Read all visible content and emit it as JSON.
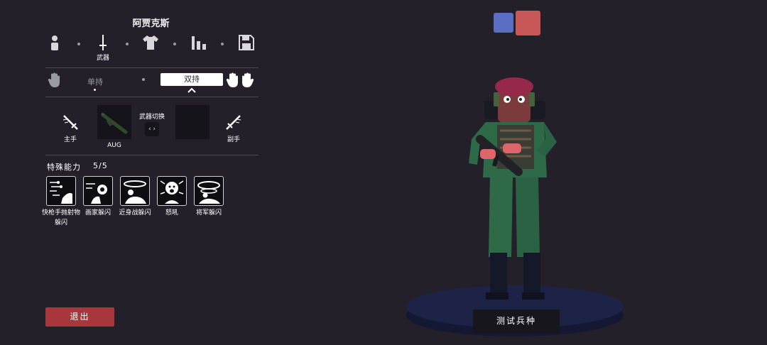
{
  "unit": {
    "name": "阿贾克斯"
  },
  "categories": [
    {
      "id": "body",
      "icon": "person-icon",
      "label": ""
    },
    {
      "id": "weapon",
      "icon": "sword-icon",
      "label": "武器"
    },
    {
      "id": "clothing",
      "icon": "shirt-icon",
      "label": ""
    },
    {
      "id": "stats",
      "icon": "bar-chart-icon",
      "label": ""
    },
    {
      "id": "save",
      "icon": "floppy-disk-icon",
      "label": ""
    }
  ],
  "grip": {
    "single": "单持",
    "dual": "双持",
    "selected": "dual"
  },
  "weapons": {
    "main_label": "主手",
    "main_weapon": "AUG",
    "switch_label": "武器切换",
    "switch_glyph": "‹ ›",
    "off_label": "副手"
  },
  "abilities": {
    "title": "特殊能力",
    "count": "5/5",
    "items": [
      {
        "name": "快枪手抛射物躲闪",
        "icon": "gunslinger-dodge-icon"
      },
      {
        "name": "画家躲闪",
        "icon": "painter-dodge-icon"
      },
      {
        "name": "近身战躲闪",
        "icon": "melee-dodge-icon"
      },
      {
        "name": "怒吼",
        "icon": "roar-icon"
      },
      {
        "name": "将军躲闪",
        "icon": "general-dodge-icon"
      }
    ]
  },
  "buttons": {
    "exit": "退出",
    "test_unit": "测试兵种"
  },
  "teams": [
    {
      "name": "blue",
      "color": "#5a6ec4"
    },
    {
      "name": "red",
      "color": "#c85858"
    }
  ]
}
